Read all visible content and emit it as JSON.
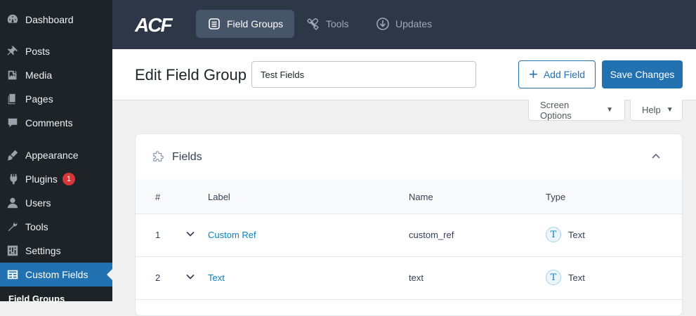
{
  "sidebar": {
    "items": [
      {
        "label": "Dashboard",
        "icon": "dashboard-icon"
      },
      {
        "label": "Posts",
        "icon": "pin-icon"
      },
      {
        "label": "Media",
        "icon": "media-icon"
      },
      {
        "label": "Pages",
        "icon": "pages-icon"
      },
      {
        "label": "Comments",
        "icon": "comment-icon"
      },
      {
        "label": "Appearance",
        "icon": "brush-icon"
      },
      {
        "label": "Plugins",
        "icon": "plugin-icon",
        "badge": "1"
      },
      {
        "label": "Users",
        "icon": "user-icon"
      },
      {
        "label": "Tools",
        "icon": "wrench-icon"
      },
      {
        "label": "Settings",
        "icon": "settings-icon"
      },
      {
        "label": "Custom Fields",
        "icon": "table-icon"
      }
    ],
    "submenu_first": "Field Groups"
  },
  "topbar": {
    "logo": "ACF",
    "tabs": [
      {
        "label": "Field Groups"
      },
      {
        "label": "Tools"
      },
      {
        "label": "Updates"
      }
    ]
  },
  "header": {
    "title": "Edit Field Group",
    "field_group_name": "Test Fields",
    "add_field_label": "Add Field",
    "save_label": "Save Changes"
  },
  "screen_meta": {
    "screen_options_label": "Screen Options",
    "help_label": "Help"
  },
  "fields_panel": {
    "title": "Fields",
    "columns": [
      "#",
      "Label",
      "Name",
      "Type"
    ],
    "rows": [
      {
        "order": "1",
        "label": "Custom Ref",
        "name": "custom_ref",
        "type": "Text",
        "type_icon": "T"
      },
      {
        "order": "2",
        "label": "Text",
        "name": "text",
        "type": "Text",
        "type_icon": "T"
      }
    ]
  },
  "colors": {
    "sidebar_bg": "#1d2327",
    "topbar_bg": "#2d3748",
    "accent": "#2271b1",
    "link": "#0783be"
  }
}
